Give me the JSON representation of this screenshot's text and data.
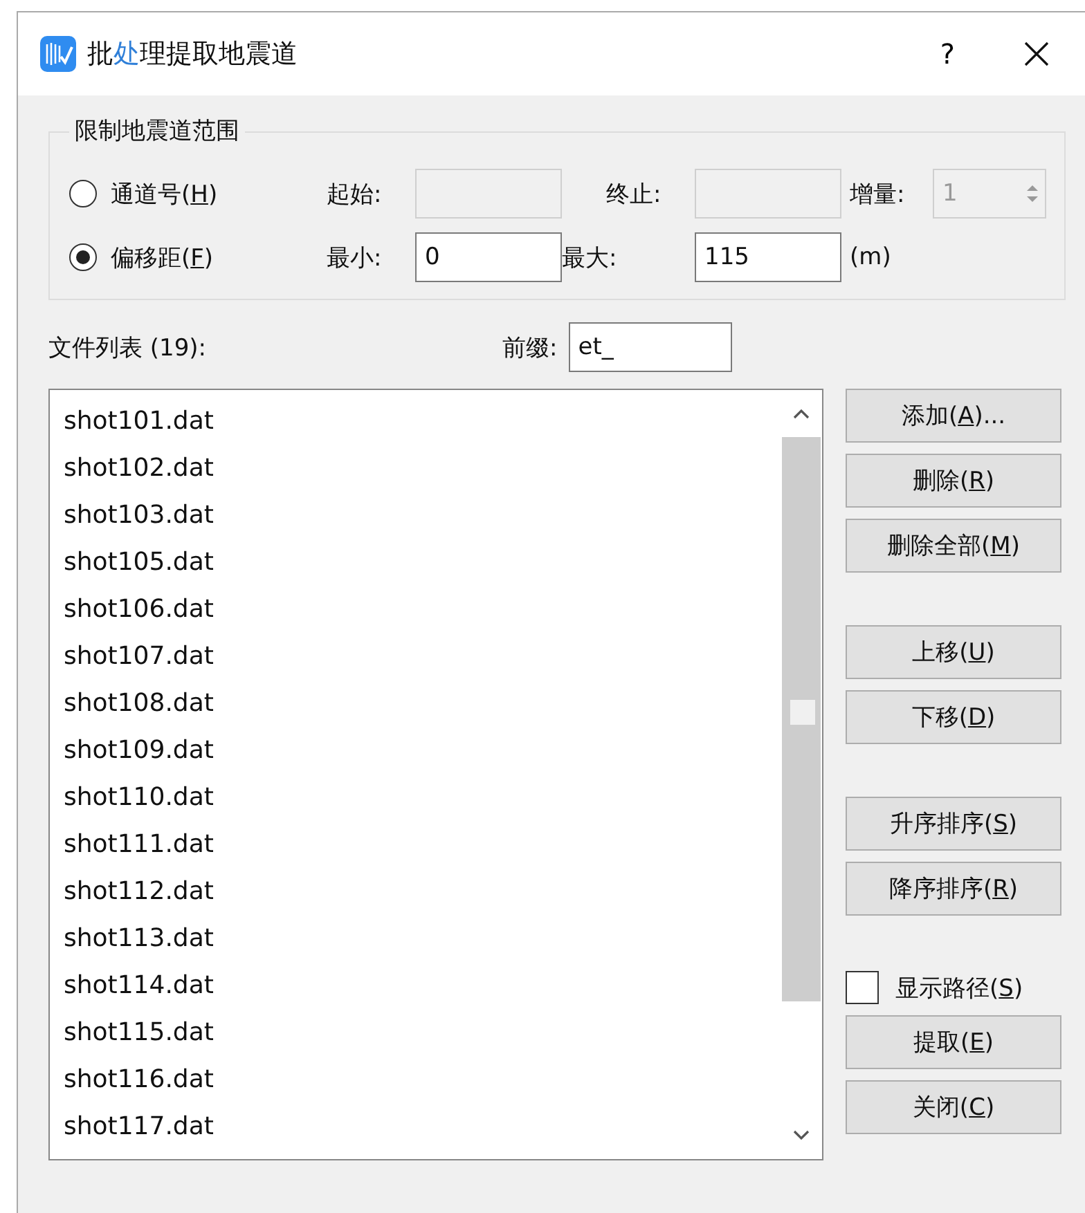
{
  "window": {
    "title_parts": [
      {
        "text": "批"
      },
      {
        "text": "处",
        "accent": true
      },
      {
        "text": "理提取地震道"
      }
    ],
    "help": "?"
  },
  "range_group": {
    "title": "限制地震道范围",
    "modes": [
      {
        "label": "通道号(H)",
        "selected": false
      },
      {
        "label": "偏移距(F)",
        "selected": true
      }
    ],
    "rows": [
      [
        {
          "label": "起始:",
          "disabled": true
        },
        {
          "label": "终止:",
          "disabled": true
        },
        {
          "label": "增量:",
          "value": "1",
          "disabled": true,
          "kind": "spin"
        }
      ],
      [
        {
          "label": "最小:",
          "value": "0",
          "disabled": false
        },
        {
          "label": "最大:",
          "value": "115",
          "disabled": false
        },
        {
          "kind": "unit",
          "text": "(m)"
        }
      ]
    ]
  },
  "file_list": {
    "label": "文件列表 (19):",
    "prefix_label": "前缀:",
    "prefix_value": "et_",
    "items": [
      "shot101.dat",
      "shot102.dat",
      "shot103.dat",
      "shot105.dat",
      "shot106.dat",
      "shot107.dat",
      "shot108.dat",
      "shot109.dat",
      "shot110.dat",
      "shot111.dat",
      "shot112.dat",
      "shot113.dat",
      "shot114.dat",
      "shot115.dat",
      "shot116.dat",
      "shot117.dat"
    ]
  },
  "side": [
    {
      "kind": "button",
      "label": "添加(A)..."
    },
    {
      "kind": "button",
      "label": "删除(R)"
    },
    {
      "kind": "button",
      "label": "删除全部(M)"
    },
    {
      "kind": "gap"
    },
    {
      "kind": "button",
      "label": "上移(U)"
    },
    {
      "kind": "button",
      "label": "下移(D)"
    },
    {
      "kind": "gap"
    },
    {
      "kind": "button",
      "label": "升序排序(S)"
    },
    {
      "kind": "button",
      "label": "降序排序(R)"
    },
    {
      "kind": "gap"
    },
    {
      "kind": "checkbox",
      "label": "显示路径(S)",
      "checked": false
    },
    {
      "kind": "button",
      "label": "提取(E)"
    },
    {
      "kind": "button",
      "label": "关闭(C)"
    }
  ]
}
